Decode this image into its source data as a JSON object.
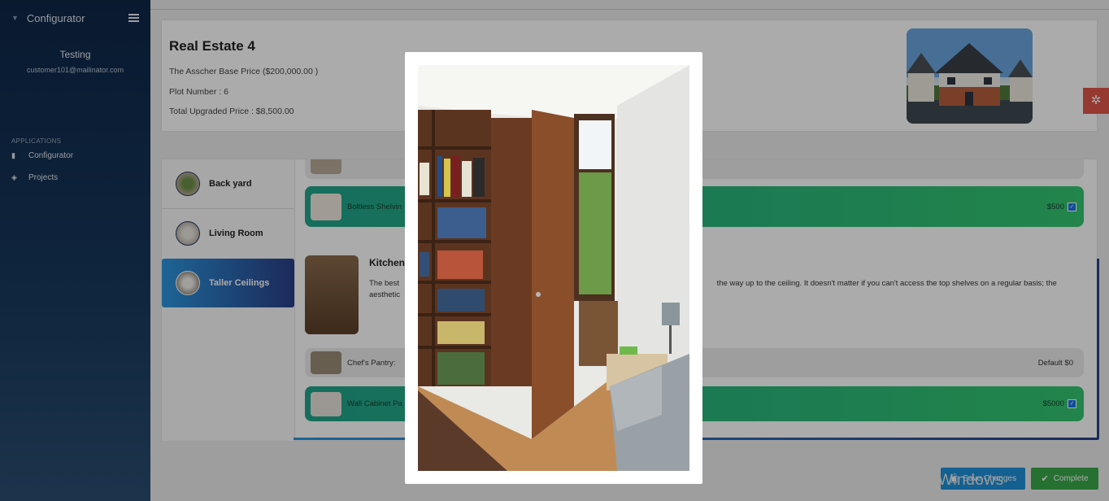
{
  "sidebar": {
    "brand": "Configurator",
    "user_name": "Testing",
    "user_email": "customer101@mailinator.com",
    "section_label": "APPLICATIONS",
    "items": [
      {
        "label": "Configurator",
        "icon": "document-icon"
      },
      {
        "label": "Projects",
        "icon": "layers-icon"
      }
    ]
  },
  "header": {
    "title": "Real Estate 4",
    "base_price": "The Asscher Base Price ($200,000.00 )",
    "plot": "Plot Number : 6",
    "total": "Total Upgraded Price : $8,500.00"
  },
  "tabs": [
    {
      "label": "Back yard"
    },
    {
      "label": "Living Room"
    },
    {
      "label": "Taller Ceilings"
    }
  ],
  "options": {
    "boltless": {
      "label": "Boltless Shelvin",
      "price": "$500"
    },
    "kitchen_title": "Kitchen",
    "kitchen_desc_a": "The best ",
    "kitchen_desc_b": "the way up to the ceiling. It doesn't matter if you can't access the top shelves on a regular basis; the",
    "kitchen_desc_c": "aesthetic ",
    "chefs_pantry": {
      "label": "Chef's Pantry:",
      "price": "Default $0"
    },
    "wall_cabinet": {
      "label": "Wall Cabinet Pa",
      "price": "$5000"
    }
  },
  "buttons": {
    "save": "Save Changes",
    "complete": "Complete"
  },
  "watermark": "Windows",
  "colors": {
    "accent_blue": "#2c96df",
    "accent_navy": "#2b3f87",
    "option_green": "#33c670",
    "settings_red": "#e0554a",
    "complete_green": "#3aa84a"
  }
}
